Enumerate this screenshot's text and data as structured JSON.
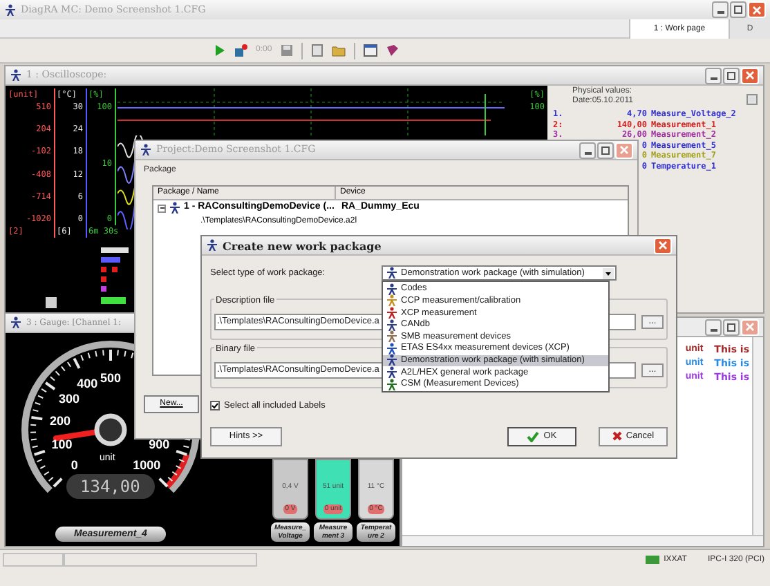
{
  "app": {
    "title": "DiagRA MC: Demo Screenshot 1.CFG",
    "tabs": [
      {
        "label": "1 : Work page",
        "selected": true
      },
      {
        "label": "D",
        "selected": false
      }
    ],
    "toolbar_time": "0:00"
  },
  "oscilloscope": {
    "title": "1 : Oscilloscope:",
    "axes": [
      {
        "unit": "[unit]",
        "ticks": [
          "510",
          "204",
          "-102",
          "-408",
          "-714",
          "-1020"
        ],
        "footer": "[2]",
        "color": "#ff5a5a"
      },
      {
        "unit": "[°C]",
        "ticks": [
          "30",
          "24",
          "18",
          "12",
          "6",
          "0"
        ],
        "footer": "[6]",
        "color": "#e6e6e6"
      },
      {
        "unit": "[%]",
        "ticks": [
          "100",
          "10",
          "0"
        ],
        "footer": "6m 30s",
        "color": "#3cc83c"
      }
    ],
    "right_axis": {
      "unit": "[%]",
      "tick": "100"
    },
    "physical_values": {
      "heading": "Physical values:",
      "date": "Date:05.10.2011",
      "rows": [
        {
          "index": "1.",
          "value": "4,70",
          "name": "Measure_Voltage_2",
          "color": "#3030d0"
        },
        {
          "index": "2:",
          "value": "140,00",
          "name": "Measurement_1",
          "color": "#d02020"
        },
        {
          "index": "3.",
          "value": "26,00",
          "name": "Measurement_2",
          "color": "#a030a0"
        },
        {
          "value": "0",
          "name": "Measurement_5",
          "color": "#3030d0"
        },
        {
          "value": "0",
          "name": "Measurement_7",
          "color": "#a0a020"
        },
        {
          "value": "0",
          "name": "Temperature_1",
          "color": "#3030d0"
        }
      ]
    }
  },
  "gauge": {
    "title": "3 : Gauge: [Channel 1:",
    "ticks": [
      "500",
      "400",
      "300",
      "200",
      "100",
      "900",
      "0",
      "1000"
    ],
    "unit": "unit",
    "display": "134,00",
    "button": "Measurement_4",
    "bars": [
      {
        "mid": "0,4 V",
        "bottom": "0 V",
        "label_lines": [
          "Measure_",
          "Voltage"
        ],
        "color": "#c8c8c8"
      },
      {
        "mid": "51 unit",
        "bottom": "0 unit",
        "label_lines": [
          "Measure",
          "ment 3"
        ],
        "color": "#3ee0b4"
      },
      {
        "mid": "11 °C",
        "bottom": "0 °C",
        "label_lines": [
          "Temperat",
          "ure 2"
        ],
        "color": "#d8d8d8"
      }
    ]
  },
  "table": {
    "rows": [
      {
        "unit": "unit",
        "label": "This is",
        "color": "#a02828"
      },
      {
        "unit": "unit",
        "label": "This is",
        "color": "#2a8ae0"
      },
      {
        "unit": "unit",
        "label": "This is",
        "color": "#9a3ae0"
      }
    ]
  },
  "project": {
    "title": "Project:Demo Screenshot 1.CFG",
    "group": "Package",
    "columns": [
      "Package / Name",
      "Device"
    ],
    "rows": [
      {
        "name": "1 - RAConsultingDemoDevice (...",
        "device": "RA_Dummy_Ecu",
        "expanded": true,
        "children": [
          {
            "name": ".\\Templates\\RAConsultingDemoDevice.a2l"
          }
        ]
      }
    ],
    "new_button": "New..."
  },
  "dialog": {
    "title": "Create new work package",
    "type_label": "Select type of work package:",
    "type_value": "Demonstration work package (with simulation)",
    "options": [
      {
        "label": "Codes",
        "selected": false
      },
      {
        "label": "CCP measurement/calibration",
        "selected": false
      },
      {
        "label": "XCP measurement",
        "selected": false
      },
      {
        "label": "CANdb",
        "selected": false
      },
      {
        "label": "SMB measurement devices",
        "selected": false
      },
      {
        "label": "ETAS ES4xx measurement devices (XCP)",
        "selected": false
      },
      {
        "label": "Demonstration work package (with simulation)",
        "selected": true
      },
      {
        "label": "A2L/HEX general work package",
        "selected": false
      },
      {
        "label": "CSM (Measurement Devices)",
        "selected": false
      }
    ],
    "files": [
      {
        "legend": "Description file",
        "value": ".\\Templates\\RAConsultingDemoDevice.a",
        "browse": "..."
      },
      {
        "legend": "Binary file",
        "value": ".\\Templates\\RAConsultingDemoDevice.a",
        "browse": "..."
      }
    ],
    "select_all": {
      "label": "Select all included Labels",
      "checked": true
    },
    "hints": "Hints >>",
    "ok": "OK",
    "cancel": "Cancel"
  },
  "status_bar": {
    "device": "IXXAT",
    "interface": "IPC-I 320 (PCI)"
  }
}
